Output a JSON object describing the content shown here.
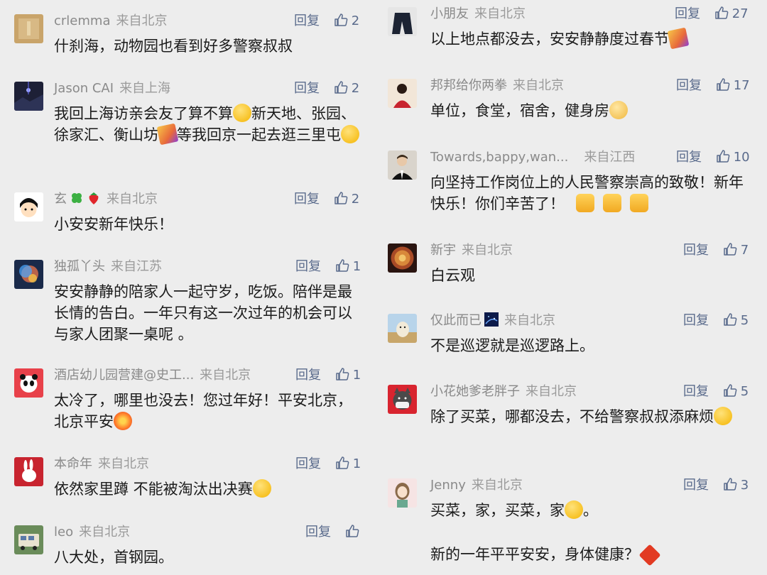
{
  "ui": {
    "reply_label": "回复",
    "from_prefix": "来自"
  },
  "colors": {
    "background": "#ededed",
    "meta_text": "#8a8a8a",
    "action_text": "#5a6b8c",
    "body_text": "#1b1b1b"
  },
  "left_comments": [
    {
      "name": "crlemma",
      "from": "来自北京",
      "likes": "2",
      "text": "什刹海，动物园也看到好多警察叔叔",
      "avatar_icon": "bookshelf-avatar"
    },
    {
      "name": "Jason CAI",
      "from": "来自上海",
      "likes": "2",
      "text_parts": [
        "我回上海访亲会友了算不算",
        "新天地、张园、徐家汇、衡山坊",
        "等我回京一起去逛三里屯"
      ],
      "avatar_icon": "night-sky-avatar"
    },
    {
      "name": "玄",
      "from": "来自北京",
      "likes": "2",
      "text": "小安安新年快乐！",
      "avatar_icon": "cartoon-girl-avatar"
    },
    {
      "name": "独孤丫头",
      "from": "来自江苏",
      "likes": "1",
      "text": "安安静静的陪家人一起守岁，吃饭。陪伴是最长情的告白。一年只有这一次过年的机会可以与家人团聚一桌呢 。",
      "avatar_icon": "galaxy-avatar"
    },
    {
      "name": "酒店幼儿园营建@史工...",
      "from": "来自北京",
      "likes": "1",
      "text_parts": [
        "太冷了，哪里也没去！您过年好！平安北京，北京平安"
      ],
      "avatar_icon": "panda-avatar"
    },
    {
      "name": "本命年",
      "from": "来自北京",
      "likes": "1",
      "text_parts": [
        "依然家里蹲 不能被淘汰出决赛"
      ],
      "avatar_icon": "rabbit-avatar"
    },
    {
      "name": "leo",
      "from": "来自北京",
      "likes": "",
      "text": "八大处，首钢园。",
      "avatar_icon": "vehicle-avatar"
    }
  ],
  "right_comments": [
    {
      "name": "小朋友",
      "from": "来自北京",
      "likes": "27",
      "text_parts": [
        "以上地点都没去，安安静静度过春节"
      ],
      "avatar_icon": "jacket-avatar"
    },
    {
      "name": "邦邦给你两拳",
      "from": "来自北京",
      "likes": "17",
      "text_parts": [
        "单位，食堂，宿舍，健身房"
      ],
      "avatar_icon": "red-girl-avatar"
    },
    {
      "name": "Towards,bappy,wan...",
      "from": "来自江西",
      "likes": "10",
      "text_parts": [
        "向坚持工作岗位上的人民警察崇高的致敬！新年快乐！你们辛苦了！"
      ],
      "avatar_icon": "person-avatar"
    },
    {
      "name": "新宇",
      "from": "来自北京",
      "likes": "7",
      "text": "白云观",
      "avatar_icon": "dome-avatar"
    },
    {
      "name": "仅此而已",
      "from": "来自北京",
      "likes": "5",
      "text": "不是巡逻就是巡逻路上。",
      "avatar_icon": "dog-avatar"
    },
    {
      "name": "小花她爹老胖子",
      "from": "来自北京",
      "likes": "5",
      "text_parts": [
        "除了买菜，哪都没去，不给警察叔叔添麻烦"
      ],
      "avatar_icon": "masked-cat-avatar"
    },
    {
      "name": "Jenny",
      "from": "来自北京",
      "likes": "3",
      "text_parts": [
        "买菜，家，买菜，家",
        "。",
        "新的一年平平安安，身体健康？"
      ],
      "avatar_icon": "cartoon-woman-avatar"
    }
  ]
}
